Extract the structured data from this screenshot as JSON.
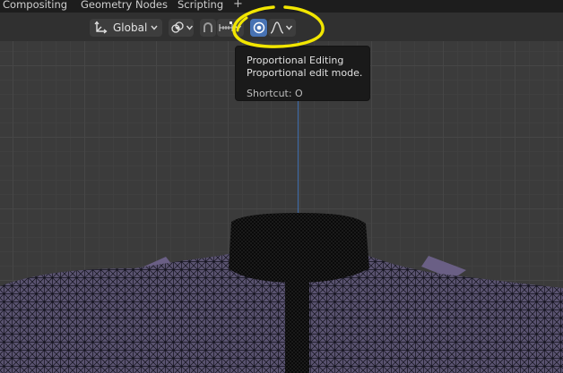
{
  "workspace_tabs": {
    "compositing": "Compositing",
    "geometry_nodes": "Geometry Nodes",
    "scripting": "Scripting",
    "add": "+"
  },
  "header": {
    "transform_orientation": {
      "label": "Global",
      "icon": "orientation-gizmo-icon"
    },
    "pivot_point": {
      "icon": "pivot-icon"
    },
    "snap": {
      "icon": "magnet-icon"
    },
    "snap_increment": {
      "icon": "snap-increment-icon"
    },
    "proportional_editing": {
      "icon": "proportional-edit-icon",
      "active": true
    },
    "proportional_falloff": {
      "icon": "falloff-smooth-icon"
    }
  },
  "tooltip": {
    "title": "Proportional Editing",
    "description": "Proportional edit mode.",
    "shortcut": "Shortcut: O"
  },
  "colors": {
    "accent_active": "#4772b3",
    "z_axis": "#3f6fb0",
    "annotation": "#f2e600",
    "mesh_fill": "#5a5370"
  }
}
